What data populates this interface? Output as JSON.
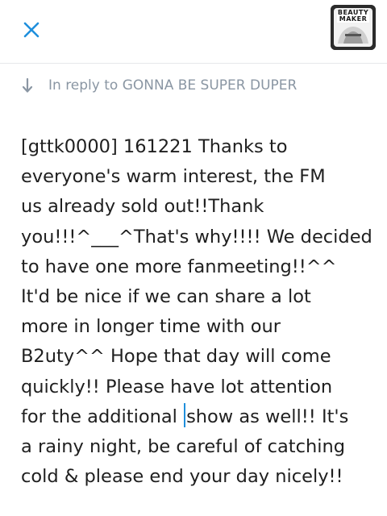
{
  "header": {
    "close_icon": "close-x-icon",
    "accent_color": "#1f8fdc",
    "avatar": {
      "icon": "profile-avatar",
      "text": "BEAUTY MAKER"
    }
  },
  "reply": {
    "icon": "reply-down-arrow-icon",
    "text": "In reply to GONNA BE SUPER DUPER"
  },
  "tweet": {
    "lines": [
      "[gttk0000] 161221 Thanks to",
      "everyone's warm interest, the FM",
      "us already sold out!!Thank",
      "you!!!^___^That's why!!!! We decided",
      "to have one more fanmeeting!!^^",
      "It'd be nice if we can share a lot",
      "more in longer time with our",
      "B2uty^^ Hope that day will come",
      "quickly!! Please have lot attention"
    ],
    "caret_line": {
      "before": "for the additional ",
      "after": "show as well!! It's"
    },
    "lines_after": [
      "a rainy night, be careful of catching",
      "cold & please end your day nicely!!"
    ]
  }
}
